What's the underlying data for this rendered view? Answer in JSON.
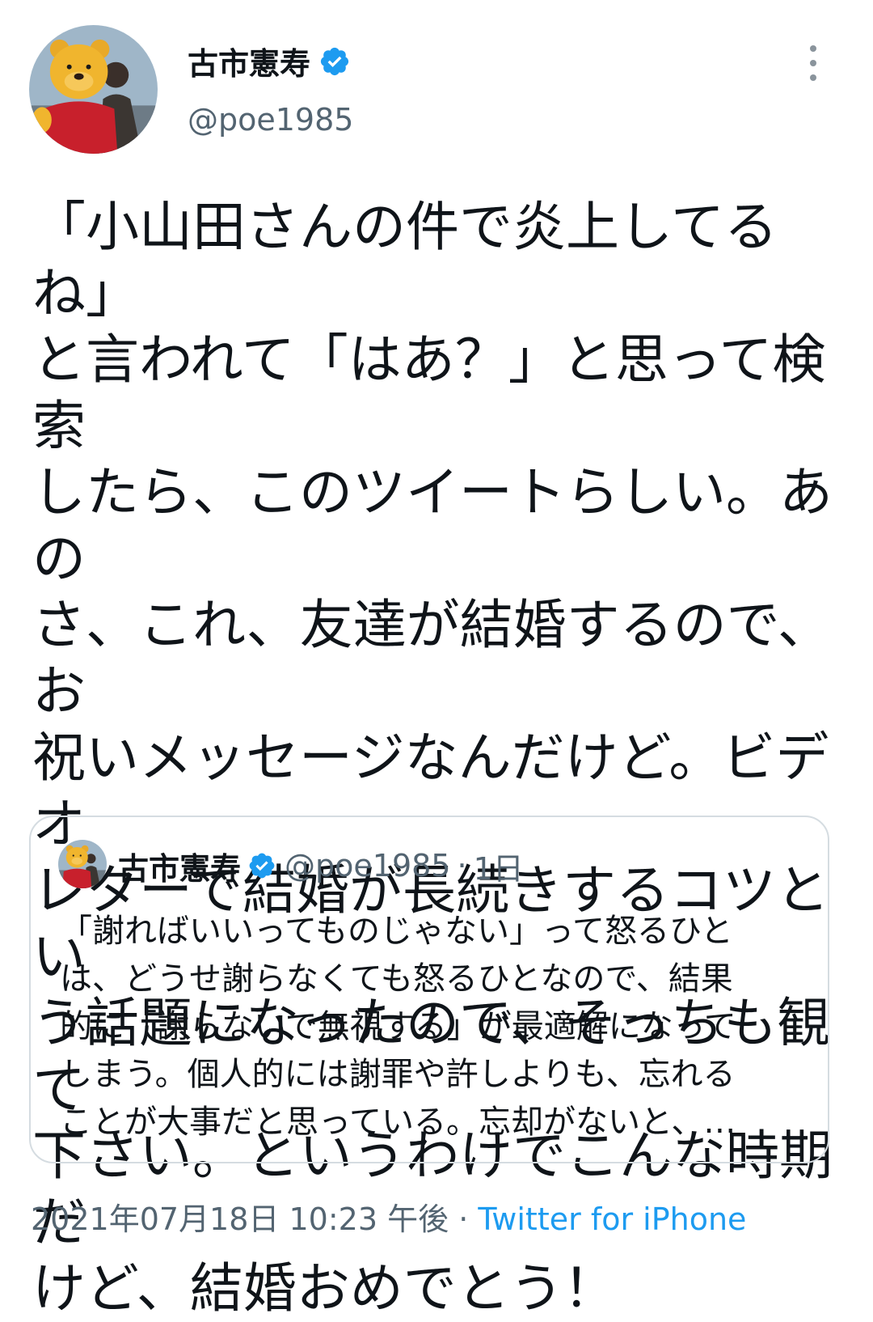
{
  "author": {
    "display_name": "古市憲寿",
    "handle": "@poe1985"
  },
  "tweet": {
    "lines": [
      "「小山田さんの件で炎上してるね」",
      "と言われて「はあ？」と思って検索",
      "したら、このツイートらしい。あの",
      "さ、これ、友達が結婚するので、お",
      "祝いメッセージなんだけど。ビデオ",
      "レターで結婚が長続きするコツとい",
      "う話題になったので、そっちも観て",
      "下さい。というわけでこんな時期だ",
      "けど、結婚おめでとう！"
    ]
  },
  "quoted": {
    "display_name": "古市憲寿",
    "handle": "@poe1985",
    "separator": "·",
    "age": "1日",
    "lines": [
      "「謝ればいいってものじゃない」って怒るひと",
      "は、どうせ謝らなくても怒るひとなので、結果",
      "的に「謝らないで無視する」が最適解になって",
      "しまう。個人的には謝罪や許しよりも、忘れる",
      "ことが大事だと思っている。忘却がないと、…"
    ]
  },
  "footer": {
    "timestamp": "2021年07月18日 10:23 午後",
    "separator": "·",
    "source": "Twitter for iPhone"
  },
  "colors": {
    "verified_blue": "#1d9bf0",
    "secondary_text": "#536471",
    "link": "#1d9bf0",
    "card_border": "#d5dce1"
  },
  "icons": [
    "verified-badge-icon",
    "more-options-icon"
  ]
}
